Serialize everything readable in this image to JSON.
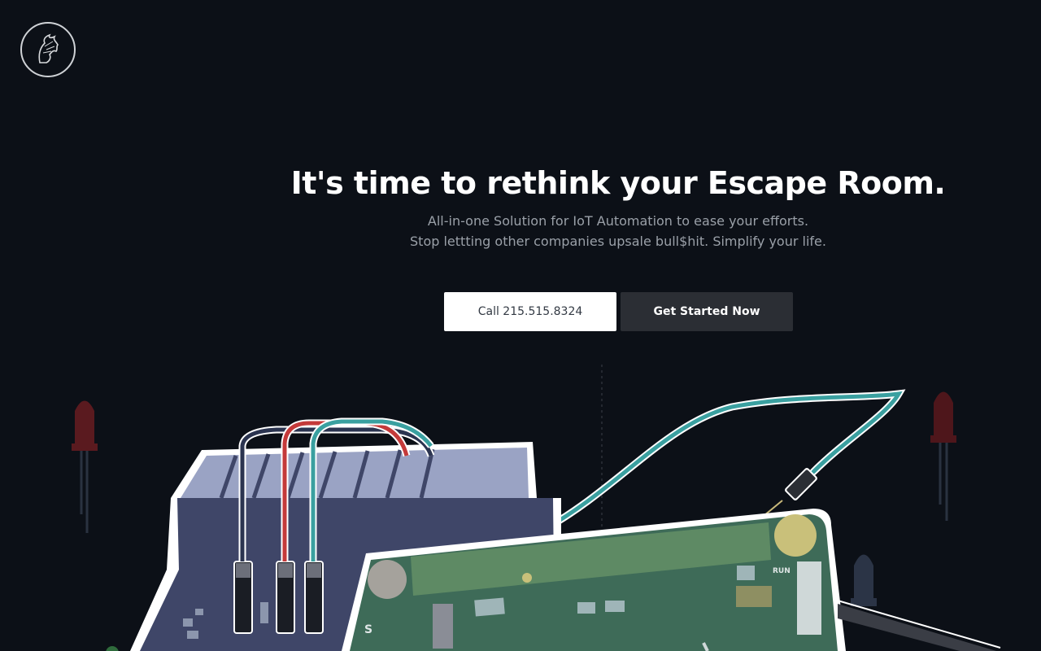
{
  "brand": {
    "logo_icon": "horse-head-logo-icon"
  },
  "hero": {
    "title": "It's time to rethink your Escape Room.",
    "subtitle_line1": "All-in-one Solution for IoT Automation to ease your efforts.",
    "subtitle_line2": "Stop lettting other companies upsale bull$hit. Simplify your life."
  },
  "buttons": {
    "call_label": "Call 215.515.8324",
    "start_label": "Get Started Now"
  },
  "illustration": {
    "icon": "iot-hardware-illustration",
    "board_labels": {
      "run": "RUN",
      "s": "S"
    }
  },
  "colors": {
    "background": "#0c1017",
    "call_button_bg": "#ffffff",
    "start_button_bg": "#2b2e34",
    "board_green": "#3e6b58",
    "breadboard_blue": "#9aa3c4",
    "wire_teal": "#3aa0a0",
    "wire_red": "#c43a3a",
    "led_red": "#5a1a1f"
  }
}
